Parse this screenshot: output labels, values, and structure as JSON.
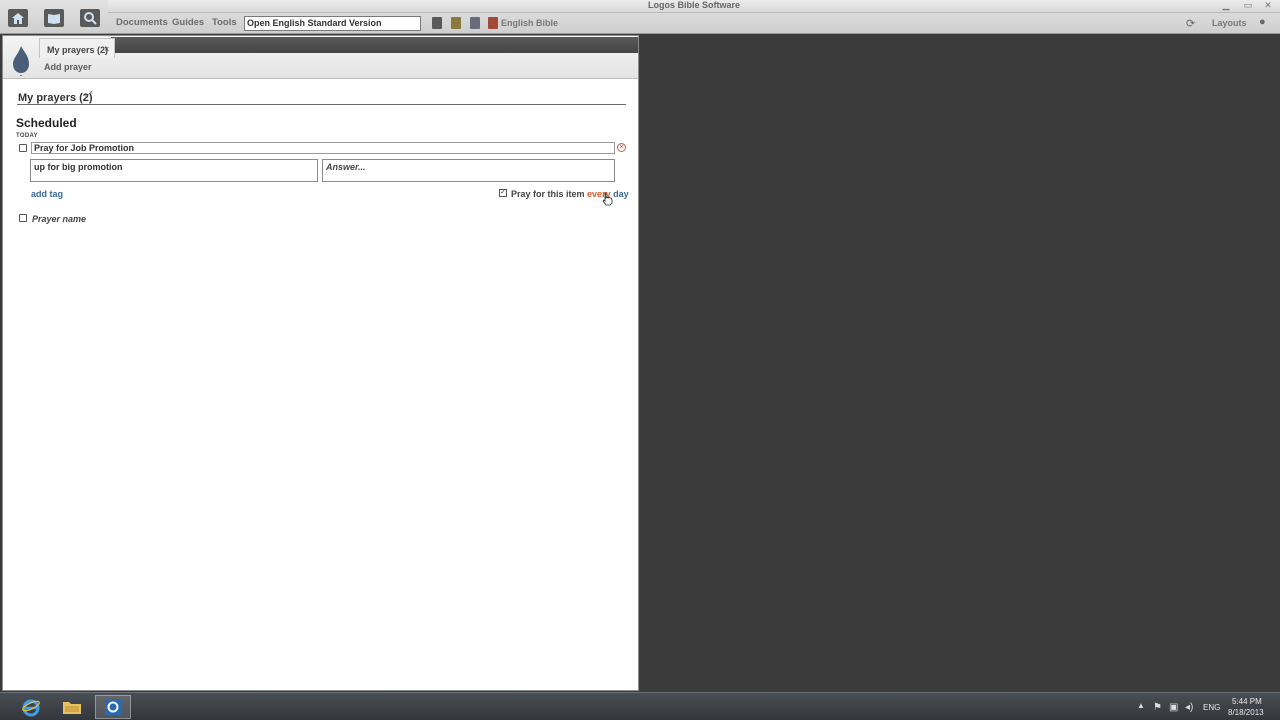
{
  "window": {
    "title": "Logos Bible Software"
  },
  "toolbar": {
    "menus": [
      "Documents",
      "Guides",
      "Tools"
    ],
    "bible_select": "Open English Standard Version",
    "parallel_label": "English Bible",
    "layouts_label": "Layouts"
  },
  "panel": {
    "tab_label": "My prayers (2)",
    "tab_close": "×",
    "add_prayer": "Add prayer",
    "title": "My prayers (2)",
    "section": "Scheduled",
    "day_label": "TODAY",
    "prayer": {
      "title": "Pray for Job Promotion",
      "details": "up for big promotion",
      "answer_placeholder": "Answer...",
      "add_tag": "add tag",
      "schedule_prefix": "Pray for this item",
      "schedule_frequency": "every",
      "schedule_unit": "day"
    },
    "new_prayer_placeholder": "Prayer name"
  },
  "taskbar": {
    "language": "ENG",
    "time": "5:44 PM",
    "date": "8/18/2013"
  },
  "colors": {
    "accent_orange": "#e05a2a",
    "link_blue": "#3a6a9a",
    "desktop_bg": "#3b3b3b"
  }
}
